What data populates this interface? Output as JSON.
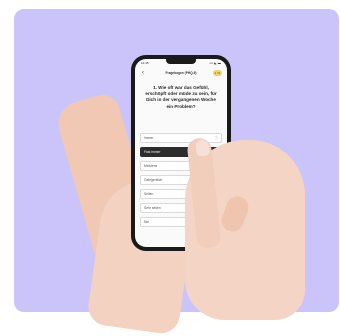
{
  "status_bar": {
    "time": "12:45",
    "signal": "▪▪▪ ◣ ▬"
  },
  "header": {
    "back_icon": "‹",
    "title": "Fragebogen (PHQ-9)",
    "badge": "1 / 9"
  },
  "question": "1. Wie oft war das Gefühl, erschöpft oder müde zu sein, für Dich in der vergangenen Woche ein Problem?",
  "options": [
    {
      "label": "Immer",
      "selected": false,
      "icon": "ⓘ"
    },
    {
      "label": "Fast immer",
      "selected": true,
      "icon": ""
    },
    {
      "label": "Meistens",
      "selected": false,
      "icon": ""
    },
    {
      "label": "Gelegentlich",
      "selected": false,
      "icon": ""
    },
    {
      "label": "Selten",
      "selected": false,
      "icon": ""
    },
    {
      "label": "Sehr selten",
      "selected": false,
      "icon": ""
    },
    {
      "label": "Nie",
      "selected": false,
      "icon": ""
    }
  ],
  "colors": {
    "background": "#cbc4fb",
    "selected_option": "#2c2c2c",
    "badge": "#f3d36b"
  }
}
